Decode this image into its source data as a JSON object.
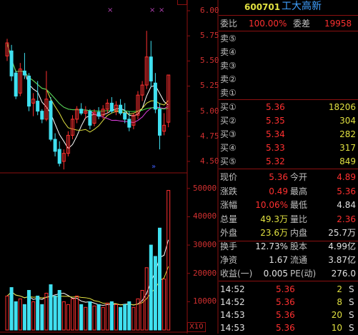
{
  "stock": {
    "code": "600701",
    "name": "工大高新"
  },
  "wei": {
    "label_bi": "委比",
    "bi": "100.00%",
    "label_cha": "委差",
    "cha": "19958"
  },
  "sell_levels": [
    "卖⑤",
    "卖④",
    "卖③",
    "卖②",
    "卖①"
  ],
  "buy_levels": [
    {
      "label": "买①",
      "price": "5.36",
      "vol": "18206"
    },
    {
      "label": "买②",
      "price": "5.35",
      "vol": "304"
    },
    {
      "label": "买③",
      "price": "5.34",
      "vol": "282"
    },
    {
      "label": "买④",
      "price": "5.33",
      "vol": "317"
    },
    {
      "label": "买⑤",
      "price": "5.32",
      "vol": "849"
    }
  ],
  "quote": [
    {
      "l1": "现价",
      "v1": "5.36",
      "l2": "今开",
      "v2": "4.89"
    },
    {
      "l1": "涨跌",
      "v1": "0.49",
      "l2": "最高",
      "v2": "5.36"
    },
    {
      "l1": "涨幅",
      "v1": "10.06%",
      "l2": "最低",
      "v2": "4.84"
    },
    {
      "l1": "总量",
      "v1": "49.3万",
      "l2": "量比",
      "v2": "2.36"
    },
    {
      "l1": "外盘",
      "v1": "23.6万",
      "l2": "内盘",
      "v2": "25.7万"
    }
  ],
  "fundamentals": [
    {
      "l1": "换手",
      "v1": "12.73%",
      "l2": "股本",
      "v2": "4.99亿"
    },
    {
      "l1": "净资",
      "v1": "1.67",
      "l2": "流通",
      "v2": "3.87亿"
    },
    {
      "l1": "收益(一)",
      "v1": "0.005",
      "l2": "PE(动)",
      "v2": "276.0"
    }
  ],
  "ticks": [
    {
      "time": "14:52",
      "price": "5.36",
      "vol": "2",
      "side": "S"
    },
    {
      "time": "14:52",
      "price": "5.36",
      "vol": "8",
      "side": "S"
    },
    {
      "time": "14:53",
      "price": "5.36",
      "vol": "20",
      "side": "S"
    },
    {
      "time": "14:53",
      "price": "5.36",
      "vol": "10",
      "side": "S"
    }
  ],
  "price_axis": [
    "6.00",
    "5.75",
    "5.50",
    "5.25",
    "5.00",
    "4.75",
    "4.50"
  ],
  "volume_axis": [
    "50000",
    "40000",
    "30000",
    "20000",
    "10000"
  ],
  "volume_unit": "X10",
  "colors": {
    "up": "#ff3030",
    "down": "#40e0f0",
    "ma5": "#ffffff",
    "ma10": "#e0e040",
    "ma20": "#e040e0",
    "ma60": "#40e040",
    "grid": "#8c1010"
  },
  "chart_data": {
    "type": "candlestick",
    "ylim_price": [
      4.4,
      6.05
    ],
    "ylim_volume": [
      0,
      55000
    ],
    "candles": [
      {
        "o": 5.55,
        "h": 5.72,
        "l": 5.5,
        "c": 5.68
      },
      {
        "o": 5.6,
        "h": 5.66,
        "l": 5.3,
        "c": 5.35
      },
      {
        "o": 5.38,
        "h": 5.4,
        "l": 5.12,
        "c": 5.15
      },
      {
        "o": 5.18,
        "h": 5.48,
        "l": 5.15,
        "c": 5.42
      },
      {
        "o": 5.4,
        "h": 5.58,
        "l": 5.32,
        "c": 5.36
      },
      {
        "o": 5.35,
        "h": 5.38,
        "l": 5.0,
        "c": 5.05
      },
      {
        "o": 5.08,
        "h": 5.18,
        "l": 4.95,
        "c": 5.12
      },
      {
        "o": 5.1,
        "h": 5.3,
        "l": 4.96,
        "c": 5.0
      },
      {
        "o": 5.0,
        "h": 5.02,
        "l": 4.88,
        "c": 4.92
      },
      {
        "o": 4.92,
        "h": 5.4,
        "l": 4.9,
        "c": 5.12
      },
      {
        "o": 5.1,
        "h": 5.14,
        "l": 4.7,
        "c": 4.72
      },
      {
        "o": 4.72,
        "h": 4.78,
        "l": 4.55,
        "c": 4.6
      },
      {
        "o": 4.62,
        "h": 4.7,
        "l": 4.45,
        "c": 4.48
      },
      {
        "o": 4.5,
        "h": 4.62,
        "l": 4.42,
        "c": 4.58
      },
      {
        "o": 4.58,
        "h": 4.8,
        "l": 4.55,
        "c": 4.76
      },
      {
        "o": 4.76,
        "h": 4.96,
        "l": 4.72,
        "c": 4.92
      },
      {
        "o": 4.92,
        "h": 5.05,
        "l": 4.88,
        "c": 5.02
      },
      {
        "o": 5.02,
        "h": 5.08,
        "l": 4.96,
        "c": 4.98
      },
      {
        "o": 4.98,
        "h": 5.05,
        "l": 4.92,
        "c": 5.0
      },
      {
        "o": 5.0,
        "h": 5.02,
        "l": 4.82,
        "c": 4.86
      },
      {
        "o": 4.88,
        "h": 5.02,
        "l": 4.85,
        "c": 4.99
      },
      {
        "o": 4.99,
        "h": 5.04,
        "l": 4.92,
        "c": 4.95
      },
      {
        "o": 4.96,
        "h": 5.06,
        "l": 4.92,
        "c": 5.02
      },
      {
        "o": 5.02,
        "h": 5.12,
        "l": 4.98,
        "c": 5.08
      },
      {
        "o": 5.08,
        "h": 5.14,
        "l": 4.98,
        "c": 5.0
      },
      {
        "o": 5.0,
        "h": 5.1,
        "l": 4.96,
        "c": 5.06
      },
      {
        "o": 5.06,
        "h": 5.12,
        "l": 4.96,
        "c": 4.98
      },
      {
        "o": 4.98,
        "h": 5.08,
        "l": 4.88,
        "c": 4.92
      },
      {
        "o": 4.92,
        "h": 5.0,
        "l": 4.8,
        "c": 4.84
      },
      {
        "o": 4.86,
        "h": 4.98,
        "l": 4.82,
        "c": 4.96
      },
      {
        "o": 4.96,
        "h": 5.2,
        "l": 4.92,
        "c": 5.16
      },
      {
        "o": 5.16,
        "h": 5.3,
        "l": 5.1,
        "c": 5.26
      },
      {
        "o": 5.26,
        "h": 5.8,
        "l": 5.22,
        "c": 5.54
      },
      {
        "o": 5.54,
        "h": 5.7,
        "l": 5.24,
        "c": 5.3
      },
      {
        "o": 5.28,
        "h": 5.38,
        "l": 4.98,
        "c": 5.02
      },
      {
        "o": 5.02,
        "h": 5.08,
        "l": 4.62,
        "c": 4.76
      },
      {
        "o": 4.8,
        "h": 4.98,
        "l": 4.76,
        "c": 4.86
      },
      {
        "o": 4.89,
        "h": 5.36,
        "l": 4.84,
        "c": 5.36
      }
    ],
    "volumes": [
      12000,
      15000,
      10000,
      11000,
      9000,
      14000,
      10000,
      12000,
      9000,
      13000,
      16000,
      12000,
      14000,
      10000,
      9000,
      11000,
      12000,
      9000,
      8000,
      10000,
      8500,
      9000,
      8000,
      9500,
      10000,
      9000,
      8000,
      9000,
      10000,
      8000,
      11000,
      14000,
      22000,
      30000,
      26000,
      36000,
      18000,
      49300
    ]
  }
}
